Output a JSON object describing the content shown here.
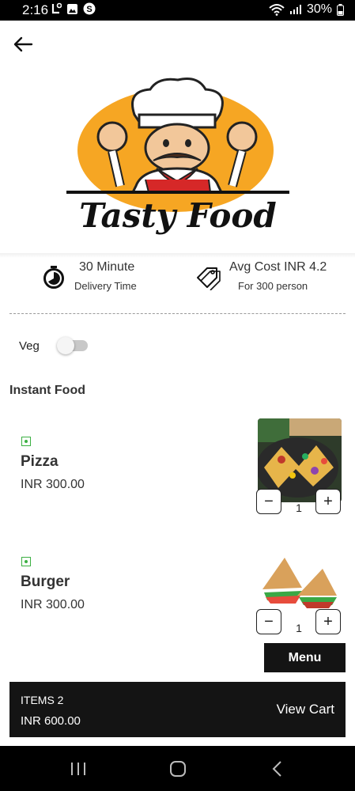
{
  "status_bar": {
    "time": "2:16",
    "battery": "30%"
  },
  "restaurant": {
    "name": "Tasty Food"
  },
  "info": {
    "delivery_title": "30 Minute",
    "delivery_subtitle": "Delivery Time",
    "cost_title": "Avg Cost INR 4.2",
    "cost_subtitle": "For 300 person"
  },
  "filter": {
    "veg_label": "Veg",
    "veg_enabled": false
  },
  "section": {
    "title": "Instant Food"
  },
  "items": [
    {
      "name": "Pizza",
      "price": "INR 300.00",
      "quantity": "1",
      "minus": "−",
      "plus": "+"
    },
    {
      "name": "Burger",
      "price": "INR 300.00",
      "quantity": "1",
      "minus": "−",
      "plus": "+"
    }
  ],
  "menu_button": {
    "label": "Menu"
  },
  "cart": {
    "items_label": "ITEMS 2",
    "total": "INR 600.00",
    "view_label": "View Cart"
  },
  "colors": {
    "accent_dark": "#141414",
    "veg_green": "#3cb043",
    "logo_orange": "#f6a623"
  }
}
